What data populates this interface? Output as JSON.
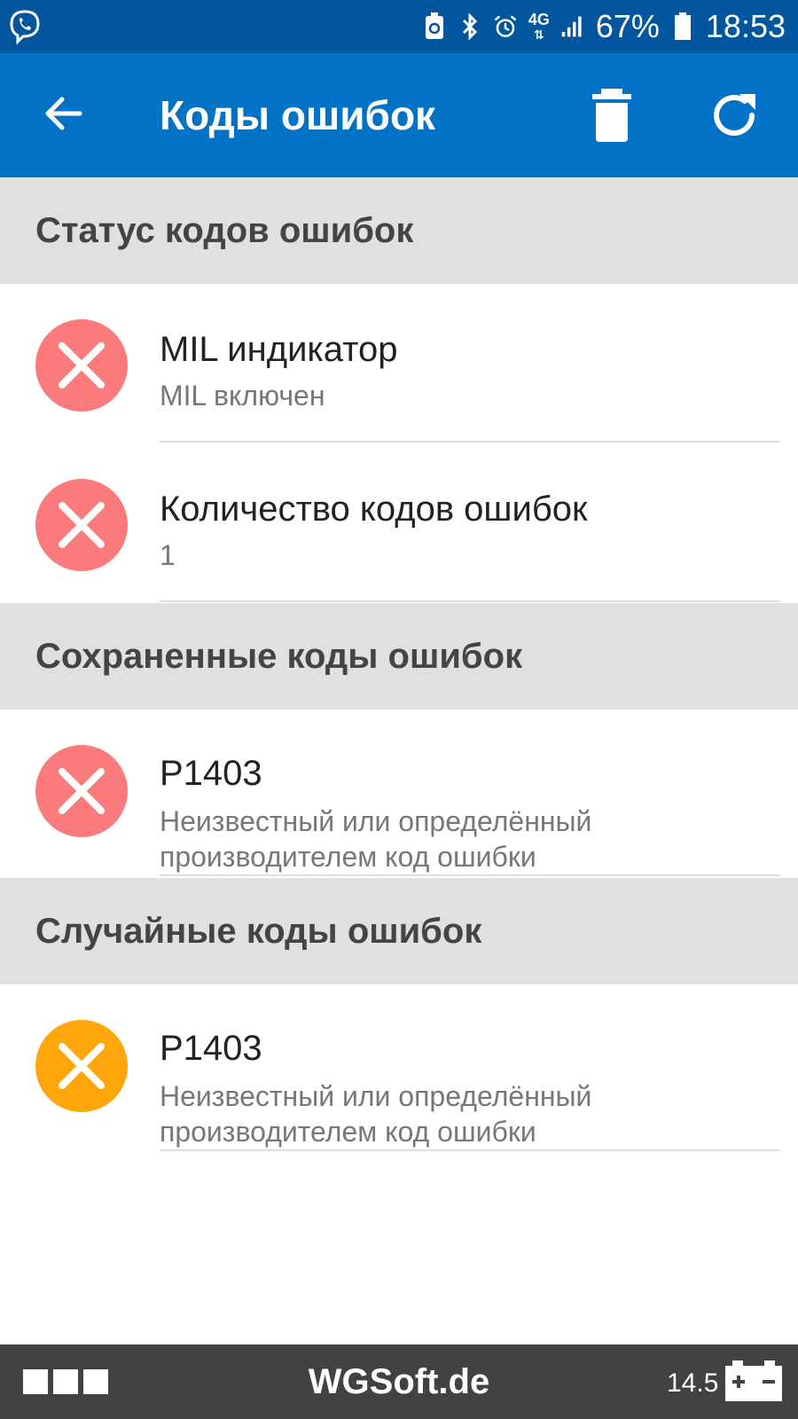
{
  "status_bar": {
    "network": "4G",
    "battery_percent": "67%",
    "time": "18:53",
    "icons": [
      "viber-icon",
      "battery-saver-icon",
      "bluetooth-icon",
      "alarm-icon",
      "network-4g-icon",
      "signal-icon",
      "battery-icon"
    ]
  },
  "app_bar": {
    "title": "Коды ошибок",
    "icons": [
      "back-arrow-icon",
      "trash-icon",
      "refresh-icon"
    ]
  },
  "sections": {
    "status": {
      "header": "Статус кодов ошибок"
    },
    "saved": {
      "header": "Сохраненные коды ошибок"
    },
    "random": {
      "header": "Случайные коды ошибок"
    }
  },
  "items": {
    "mil": {
      "title": "MIL индикатор",
      "subtitle": "MIL включен",
      "status_color": "#fb7a7c"
    },
    "count": {
      "title": "Количество кодов ошибок",
      "subtitle": "1",
      "status_color": "#fb7a7c"
    },
    "saved_code": {
      "title": "P1403",
      "subtitle": "Неизвестный или определённый производителем код ошибки",
      "status_color": "#fb7a7c"
    },
    "random_code": {
      "title": "P1403",
      "subtitle": "Неизвестный или определённый производителем код ошибки",
      "status_color": "#ffa60b"
    }
  },
  "bottom_bar": {
    "brand": "WGSoft.de",
    "voltage": "14.5",
    "icons": [
      "menu-squares-icon",
      "car-battery-icon"
    ]
  },
  "colors": {
    "status_bar_bg": "#02569e",
    "app_bar_bg": "#0272c6",
    "section_bg": "#e0e0e0",
    "error_red": "#fb7a7c",
    "warning_orange": "#ffa60b",
    "bottom_bar_bg": "#424242"
  }
}
